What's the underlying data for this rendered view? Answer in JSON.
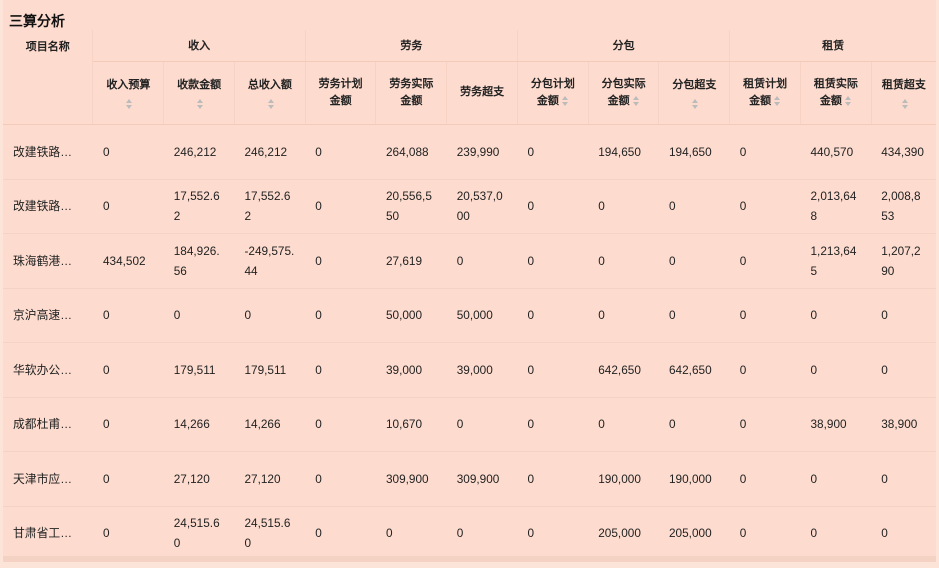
{
  "page_title": "三算分析",
  "table": {
    "name_header": "项目名称",
    "groups": [
      {
        "label": "收入"
      },
      {
        "label": "劳务"
      },
      {
        "label": "分包"
      },
      {
        "label": "租赁"
      }
    ],
    "columns": [
      {
        "label": "收入预算",
        "sortable": true
      },
      {
        "label": "收款金额",
        "sortable": true
      },
      {
        "label": "总收入额",
        "sortable": true
      },
      {
        "label": "劳务计划金额",
        "sortable": false
      },
      {
        "label": "劳务实际金额",
        "sortable": false
      },
      {
        "label": "劳务超支",
        "sortable": false
      },
      {
        "label": "分包计划金额",
        "sortable": true
      },
      {
        "label": "分包实际金额",
        "sortable": true
      },
      {
        "label": "分包超支",
        "sortable": true
      },
      {
        "label": "租赁计划金额",
        "sortable": true
      },
      {
        "label": "租赁实际金额",
        "sortable": true
      },
      {
        "label": "租赁超支",
        "sortable": true
      }
    ],
    "rows": [
      {
        "name": "改建铁路…",
        "values": [
          "0",
          "246,212",
          "246,212",
          "0",
          "264,088",
          "239,990",
          "0",
          "194,650",
          "194,650",
          "0",
          "440,570",
          "434,390"
        ]
      },
      {
        "name": "改建铁路…",
        "values": [
          "0",
          "17,552.62",
          "17,552.62",
          "0",
          "20,556,550",
          "20,537,000",
          "0",
          "0",
          "0",
          "0",
          "2,013,648",
          "2,008,853"
        ]
      },
      {
        "name": "珠海鹤港…",
        "values": [
          "434,502",
          "184,926.56",
          "-249,575.44",
          "0",
          "27,619",
          "0",
          "0",
          "0",
          "0",
          "0",
          "1,213,645",
          "1,207,290"
        ]
      },
      {
        "name": "京沪高速…",
        "values": [
          "0",
          "0",
          "0",
          "0",
          "50,000",
          "50,000",
          "0",
          "0",
          "0",
          "0",
          "0",
          "0"
        ]
      },
      {
        "name": "华软办公…",
        "values": [
          "0",
          "179,511",
          "179,511",
          "0",
          "39,000",
          "39,000",
          "0",
          "642,650",
          "642,650",
          "0",
          "0",
          "0"
        ]
      },
      {
        "name": "成都杜甫…",
        "values": [
          "0",
          "14,266",
          "14,266",
          "0",
          "10,670",
          "0",
          "0",
          "0",
          "0",
          "0",
          "38,900",
          "38,900"
        ]
      },
      {
        "name": "天津市应…",
        "values": [
          "0",
          "27,120",
          "27,120",
          "0",
          "309,900",
          "309,900",
          "0",
          "190,000",
          "190,000",
          "0",
          "0",
          "0"
        ]
      },
      {
        "name": "甘肃省工…",
        "values": [
          "0",
          "24,515.60",
          "24,515.60",
          "0",
          "0",
          "0",
          "0",
          "205,000",
          "205,000",
          "0",
          "0",
          "0"
        ]
      }
    ]
  }
}
